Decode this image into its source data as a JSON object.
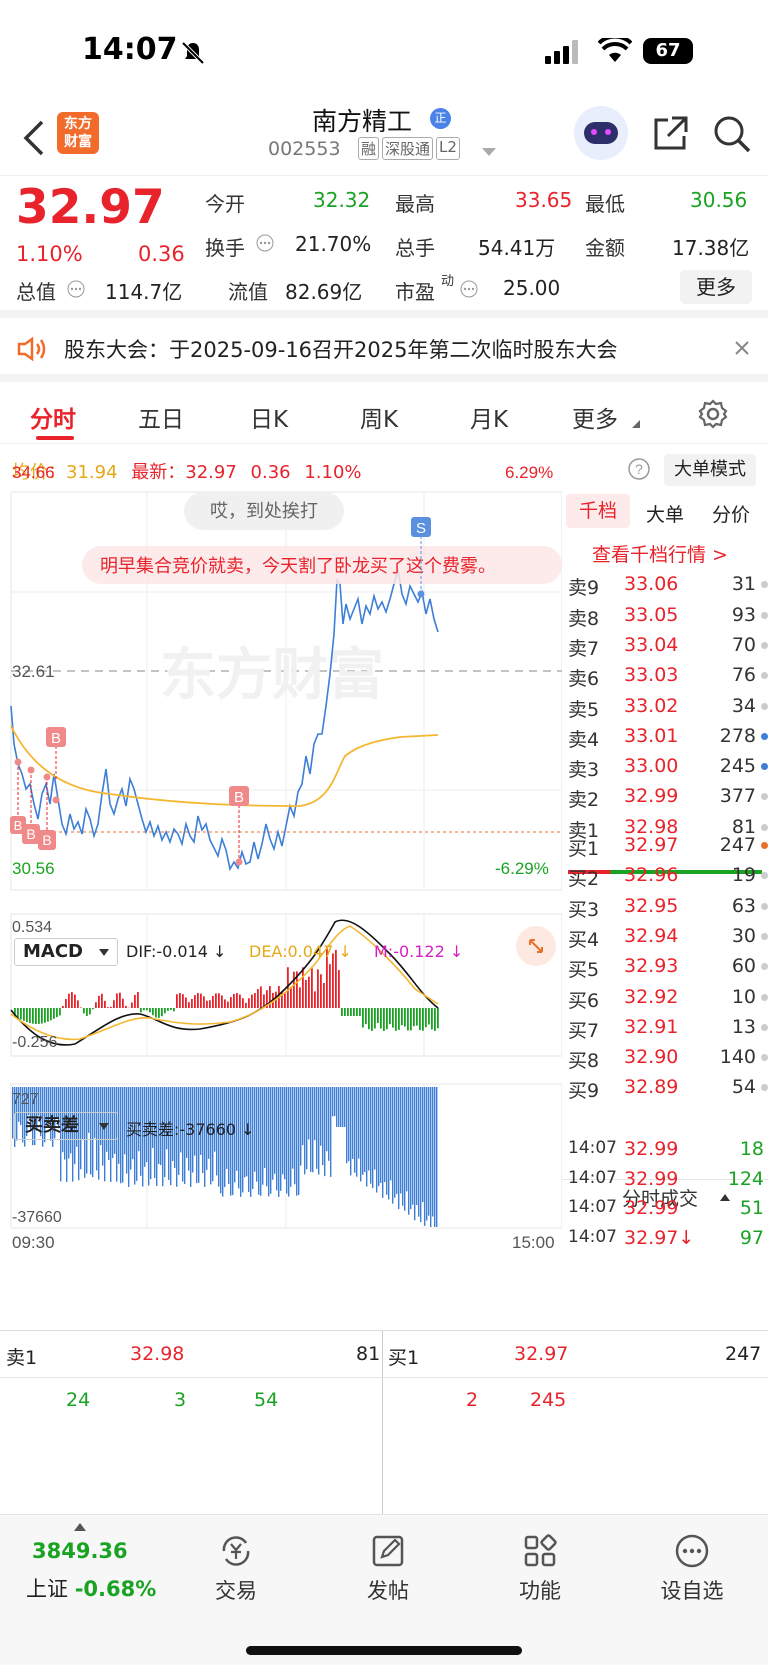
{
  "status": {
    "time": "14:07",
    "battery": "67"
  },
  "header": {
    "logo_line1": "东方",
    "logo_line2": "财富",
    "title": "南方精工",
    "code": "002553",
    "tags": [
      "融",
      "深股通",
      "L2"
    ],
    "title_badge": "正"
  },
  "quote": {
    "price": "32.97",
    "pct": "1.10%",
    "change": "0.36",
    "open_label": "今开",
    "open": "32.32",
    "high_label": "最高",
    "high": "33.65",
    "low_label": "最低",
    "low": "30.56",
    "turnover_label": "换手",
    "turnover": "21.70%",
    "volume_label": "总手",
    "volume": "54.41万",
    "amount_label": "金额",
    "amount": "17.38亿",
    "mktcap_label": "总值",
    "mktcap": "114.7亿",
    "float_label": "流值",
    "float": "82.69亿",
    "pe_label": "市盈",
    "pe_sup": "动",
    "pe": "25.00",
    "more_button": "更多"
  },
  "notice": {
    "text": "股东大会：于2025-09-16召开2025年第二次临时股东大会"
  },
  "tabs": [
    "分时",
    "五日",
    "日K",
    "周K",
    "月K",
    "更多"
  ],
  "chart": {
    "avg_label": "均价：",
    "avg": "31.94",
    "latest_label": "最新：",
    "latest": "32.97",
    "latest_change": "0.36",
    "latest_pct": "1.10%",
    "mode_button": "大单模式",
    "top_price": "34.66",
    "top_pct": "6.29%",
    "mid_price": "32.61",
    "bottom_price": "30.56",
    "bottom_pct": "-6.29%",
    "watermark": "东方财富",
    "bubble1": "哎，到处挨打",
    "bubble2": "明早集合竞价就卖，今天割了卧龙买了这个费雾。",
    "marker_buy": "B",
    "marker_sell": "S",
    "macd_label": "MACD",
    "dif": "DIF:-0.014 ↓",
    "dea": "DEA:0.047 ↓",
    "m": "M:-0.122 ↓",
    "macd_top": "0.534",
    "macd_bottom": "-0.256",
    "diff_label": "买卖差",
    "diff_value": "买卖差:-37660 ↓",
    "diff_top": "727",
    "diff_bottom": "-37660",
    "time_start": "09:30",
    "time_end": "15:00",
    "series_colors": {
      "price": "#3d7ed6",
      "avg": "#f5b731",
      "up": "#e8232b",
      "down": "#1aa323"
    }
  },
  "book": {
    "tabs": [
      "千档",
      "大单",
      "分价"
    ],
    "link": "查看千档行情 >",
    "asks": [
      {
        "label": "卖9",
        "price": "33.06",
        "vol": "31"
      },
      {
        "label": "卖8",
        "price": "33.05",
        "vol": "93"
      },
      {
        "label": "卖7",
        "price": "33.04",
        "vol": "70"
      },
      {
        "label": "卖6",
        "price": "33.03",
        "vol": "76"
      },
      {
        "label": "卖5",
        "price": "33.02",
        "vol": "34"
      },
      {
        "label": "卖4",
        "price": "33.01",
        "vol": "278"
      },
      {
        "label": "卖3",
        "price": "33.00",
        "vol": "245"
      },
      {
        "label": "卖2",
        "price": "32.99",
        "vol": "377"
      },
      {
        "label": "卖1",
        "price": "32.98",
        "vol": "81"
      }
    ],
    "bids": [
      {
        "label": "买1",
        "price": "32.97",
        "vol": "247"
      },
      {
        "label": "买2",
        "price": "32.96",
        "vol": "19"
      },
      {
        "label": "买3",
        "price": "32.95",
        "vol": "63"
      },
      {
        "label": "买4",
        "price": "32.94",
        "vol": "30"
      },
      {
        "label": "买5",
        "price": "32.93",
        "vol": "60"
      },
      {
        "label": "买6",
        "price": "32.92",
        "vol": "10"
      },
      {
        "label": "买7",
        "price": "32.91",
        "vol": "13"
      },
      {
        "label": "买8",
        "price": "32.90",
        "vol": "140"
      },
      {
        "label": "买9",
        "price": "32.89",
        "vol": "54"
      }
    ],
    "trades_title": "分时成交",
    "trades": [
      {
        "time": "14:07",
        "price": "32.99",
        "vol": "18"
      },
      {
        "time": "14:07",
        "price": "32.99",
        "vol": "124"
      },
      {
        "time": "14:07",
        "price": "32.99",
        "vol": "51"
      },
      {
        "time": "14:07",
        "price": "32.97↓",
        "vol": "97"
      }
    ]
  },
  "summary": {
    "ask1_label": "卖1",
    "ask1_price": "32.98",
    "ask1_vol": "81",
    "bid1_label": "买1",
    "bid1_price": "32.97",
    "bid1_vol": "247",
    "ask_orders": [
      "24",
      "3",
      "54"
    ],
    "bid_orders": [
      "2",
      "245"
    ]
  },
  "nav": {
    "index_value": "3849.36",
    "index_name": "上证",
    "index_pct": "-0.68%",
    "items": [
      "交易",
      "发帖",
      "功能",
      "设自选"
    ]
  }
}
